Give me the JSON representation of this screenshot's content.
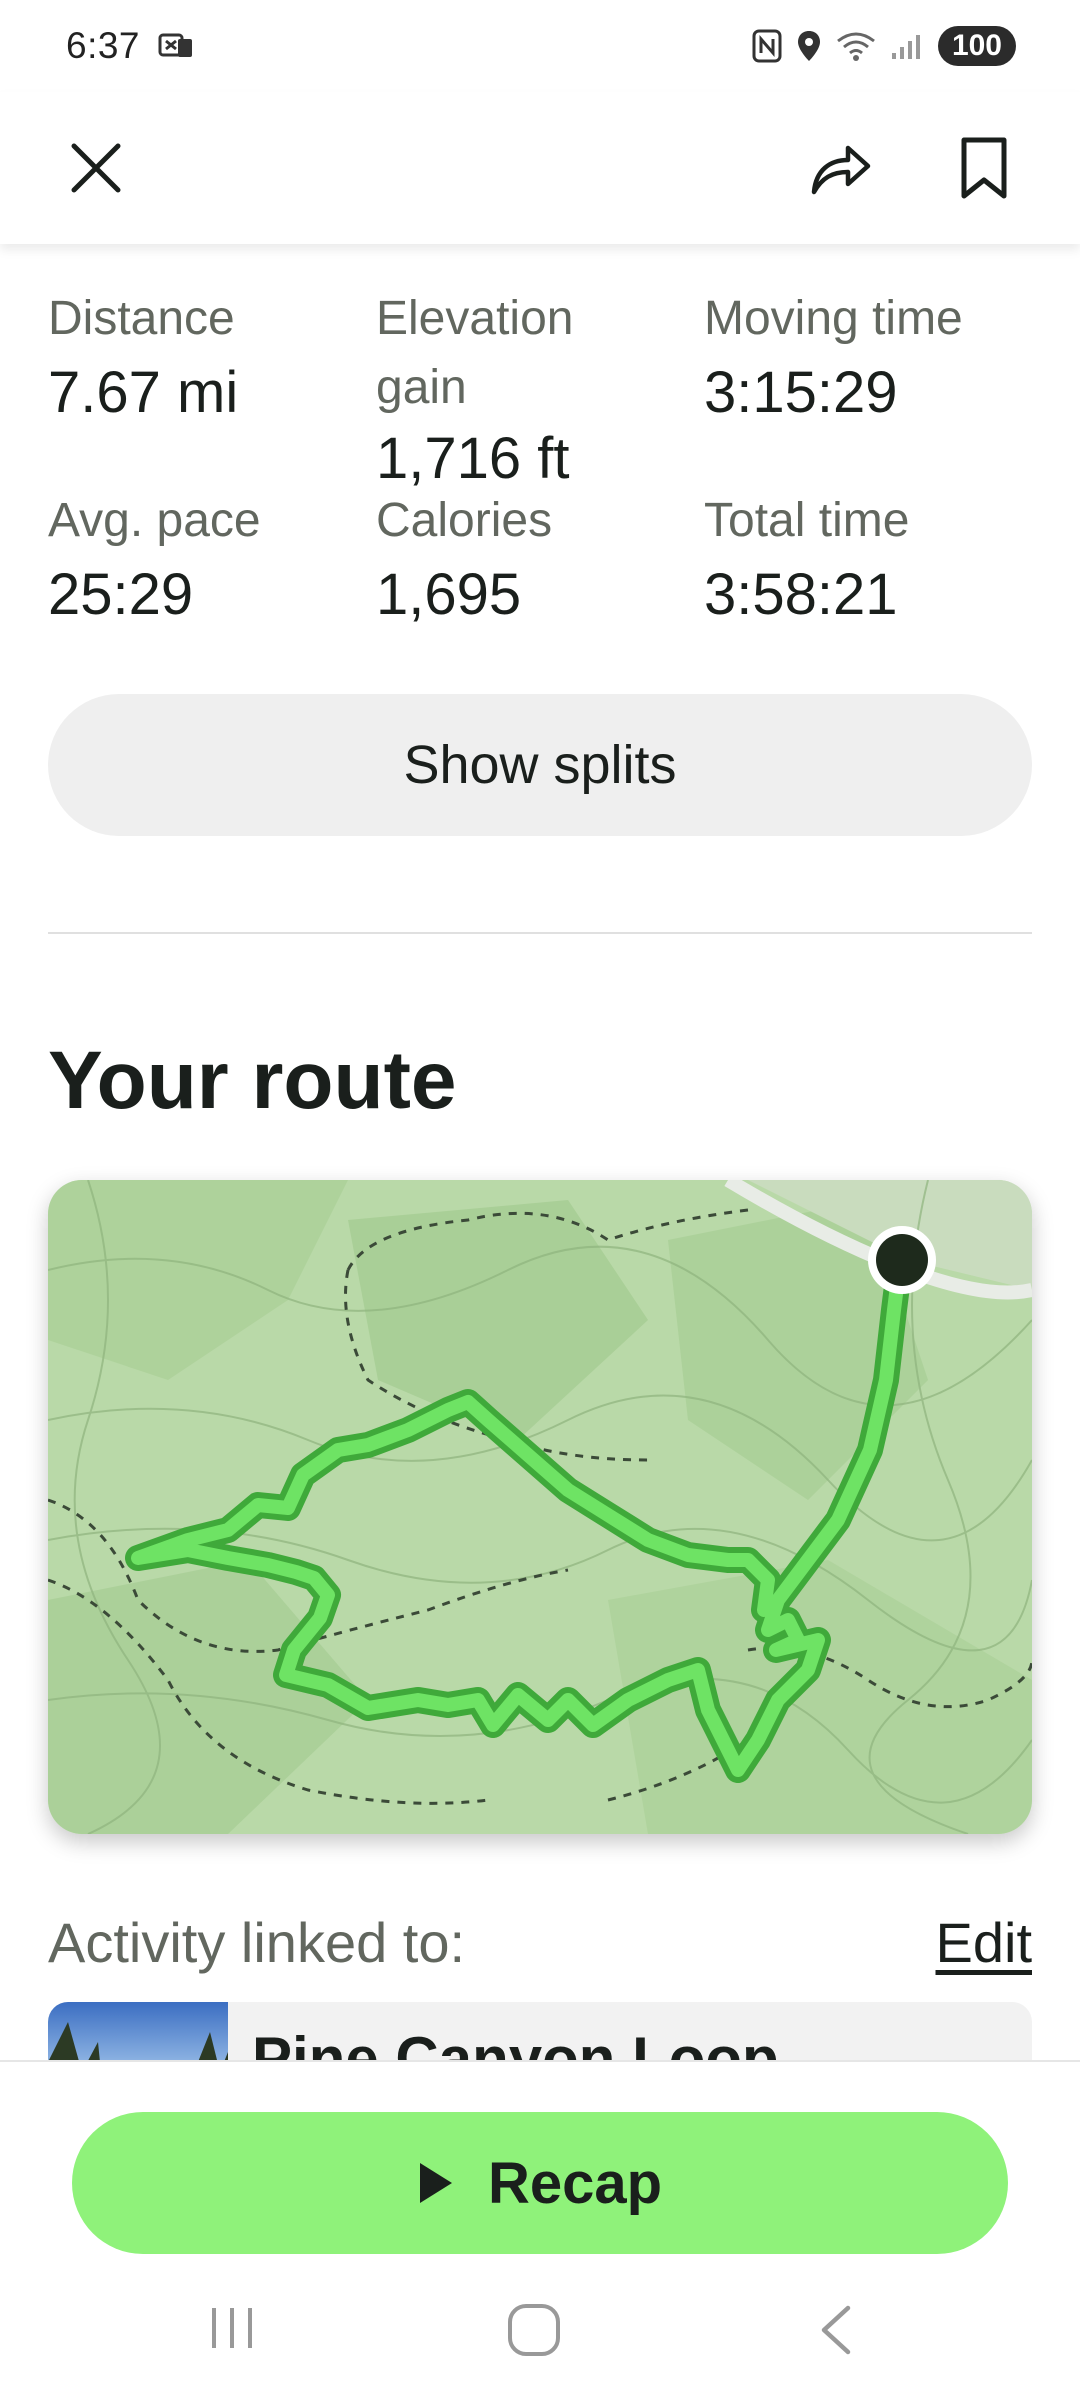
{
  "status_bar": {
    "time": "6:37",
    "battery": "100"
  },
  "top_bar": {
    "close_icon": "close-icon",
    "share_icon": "share-icon",
    "bookmark_icon": "bookmark-icon"
  },
  "stats": {
    "distance": {
      "label": "Distance",
      "value": "7.67 mi"
    },
    "elevation": {
      "label_line1": "Elevation",
      "label_line2": "gain",
      "value": "1,716 ft"
    },
    "moving_time": {
      "label": "Moving time",
      "value": "3:15:29"
    },
    "avg_pace": {
      "label": "Avg. pace",
      "value": "25:29"
    },
    "calories": {
      "label": "Calories",
      "value": "1,695"
    },
    "total_time": {
      "label": "Total time",
      "value": "3:58:21"
    }
  },
  "splits_button": "Show splits",
  "route_title": "Your route",
  "linked": {
    "label": "Activity linked to:",
    "edit": "Edit"
  },
  "trail": {
    "name": "Pine Canyon Loop"
  },
  "recap_button": "Recap",
  "colors": {
    "accent": "#8ff27a",
    "route": "#5fd65a",
    "map_bg": "#b7d8a6"
  }
}
